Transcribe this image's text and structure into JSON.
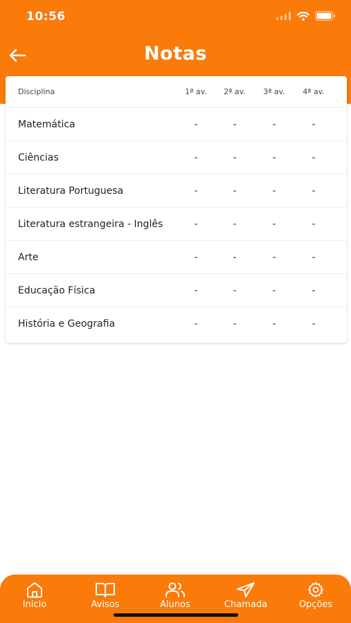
{
  "status_bar": {
    "time": "10:56"
  },
  "header": {
    "title": "Notas"
  },
  "table": {
    "columns": [
      "Disciplina",
      "1ª av.",
      "2ª av.",
      "3ª av.",
      "4ª av."
    ],
    "rows": [
      {
        "subject": "Matemática",
        "grades": [
          "-",
          "-",
          "-",
          "-"
        ]
      },
      {
        "subject": "Ciências",
        "grades": [
          "-",
          "-",
          "-",
          "-"
        ]
      },
      {
        "subject": "Literatura Portuguesa",
        "grades": [
          "-",
          "-",
          "-",
          "-"
        ]
      },
      {
        "subject": "Literatura estrangeira - Inglês",
        "grades": [
          "-",
          "-",
          "-",
          "-"
        ]
      },
      {
        "subject": "Arte",
        "grades": [
          "-",
          "-",
          "-",
          "-"
        ]
      },
      {
        "subject": "Educação Física",
        "grades": [
          "-",
          "-",
          "-",
          "-"
        ]
      },
      {
        "subject": "História e Geografia",
        "grades": [
          "-",
          "-",
          "-",
          "-"
        ]
      }
    ]
  },
  "tab_bar": {
    "items": [
      {
        "label": "Inicio",
        "icon": "home-icon"
      },
      {
        "label": "Avisos",
        "icon": "book-icon"
      },
      {
        "label": "Alunos",
        "icon": "users-icon"
      },
      {
        "label": "Chamada",
        "icon": "send-icon"
      },
      {
        "label": "Opções",
        "icon": "gear-icon"
      }
    ]
  },
  "colors": {
    "accent": "#FA7A0A",
    "background": "#FFFFFF",
    "text": "#222222"
  }
}
